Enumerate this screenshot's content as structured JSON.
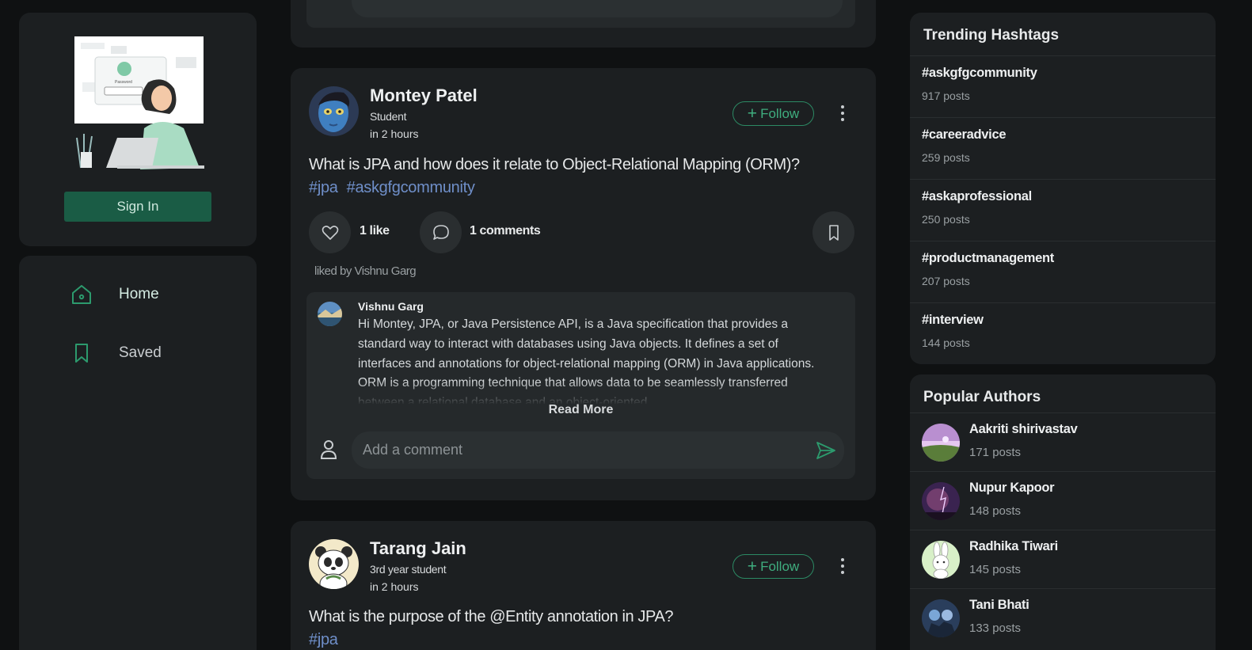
{
  "theme": {
    "accent": "#2c8a64",
    "signin_bg": "#1a5c45",
    "tag_color": "#6f8fc9",
    "background": "#0f1112",
    "card": "#1c1f21"
  },
  "sidebar": {
    "signin_label": "Sign In",
    "illustration_text": "Password",
    "nav": [
      {
        "label": "Home",
        "icon": "home-icon"
      },
      {
        "label": "Saved",
        "icon": "bookmark-icon"
      }
    ]
  },
  "feed": {
    "top_comment_placeholder": "Add a comment",
    "posts": [
      {
        "author": "Montey Patel",
        "role": "Student",
        "time": "in 2 hours",
        "follow_label": "Follow",
        "question": "What is JPA and how does it relate to Object-Relational Mapping (ORM)?",
        "tags": [
          "#jpa",
          "#askgfgcommunity"
        ],
        "likes": "1 like",
        "comments": "1 comments",
        "liked_by": "liked by Vishnu Garg",
        "comment": {
          "author": "Vishnu Garg",
          "text": "Hi Montey, JPA, or Java Persistence API, is a Java specification that provides a standard way to interact with databases using Java objects. It defines a set of interfaces and annotations for object-relational mapping (ORM) in Java applications. ORM is a programming technique that allows data to be seamlessly transferred between a relational database and an object-oriented",
          "read_more": "Read More"
        },
        "comment_placeholder": "Add a comment"
      },
      {
        "author": "Tarang Jain",
        "role": "3rd year student",
        "time": "in 2 hours",
        "follow_label": "Follow",
        "question": "What is the purpose of the @Entity annotation in JPA?",
        "tags": [
          "#jpa"
        ]
      }
    ]
  },
  "trending": {
    "title": "Trending Hashtags",
    "items": [
      {
        "tag": "#askgfgcommunity",
        "count": "917 posts"
      },
      {
        "tag": "#careeradvice",
        "count": "259 posts"
      },
      {
        "tag": "#askaprofessional",
        "count": "250 posts"
      },
      {
        "tag": "#productmanagement",
        "count": "207 posts"
      },
      {
        "tag": "#interview",
        "count": "144 posts"
      }
    ]
  },
  "authors": {
    "title": "Popular Authors",
    "items": [
      {
        "name": "Aakriti shirivastav",
        "count": "171 posts"
      },
      {
        "name": "Nupur Kapoor",
        "count": "148 posts"
      },
      {
        "name": "Radhika Tiwari",
        "count": "145 posts"
      },
      {
        "name": "Tani Bhati",
        "count": "133 posts"
      }
    ]
  }
}
